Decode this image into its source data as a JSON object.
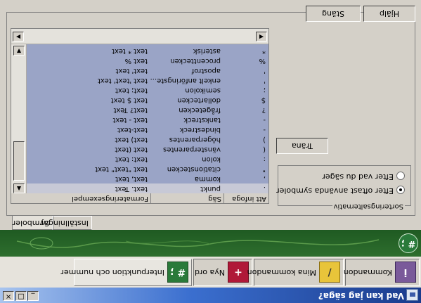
{
  "window": {
    "title": "Vad kan jag säga?",
    "controls": {
      "close": "×",
      "maximize": "□",
      "minimize": "_"
    }
  },
  "nav": {
    "tabs": [
      {
        "label": "Interpunktion och nummer",
        "icon": "punctuation-icon",
        "glyph": "# ;",
        "color": "#2a7a3a",
        "active": true
      },
      {
        "label": "Nya ord",
        "icon": "new-word-icon",
        "glyph": "+",
        "color": "#b01838",
        "active": false
      },
      {
        "label": "Mina kommandon",
        "icon": "pencil-icon",
        "glyph": "/",
        "color": "#e8c43a",
        "active": false
      },
      {
        "label": "Kommandon",
        "icon": "commands-icon",
        "glyph": "i",
        "color": "#7a5a9a",
        "active": false
      }
    ]
  },
  "banner": {
    "badge_glyph": "# ;",
    "color": "#2e6e2e"
  },
  "panel_tabs": [
    {
      "label": "Symboler",
      "active": true
    },
    {
      "label": "Inställningar",
      "active": false
    }
  ],
  "sorting": {
    "legend": "Sorteringsalternativ",
    "options": [
      {
        "label": "Efter oftast använda symboler",
        "selected": true
      },
      {
        "label": "Efter vad du säger",
        "selected": false
      }
    ]
  },
  "buttons": {
    "train": "Träna",
    "close": "Stäng",
    "help": "Hjälp"
  },
  "list": {
    "columns": {
      "write": "Att infoga",
      "say": "Säg",
      "example": "Formateringsexempel"
    },
    "rows": [
      {
        "write": ".",
        "say": "punkt",
        "example": "text. Text",
        "selected": true
      },
      {
        "write": ",",
        "say": "komma",
        "example": "text, text",
        "selected": false
      },
      {
        "write": "\"",
        "say": "citationstecken",
        "example": "text \"text\" text",
        "selected": false
      },
      {
        "write": ":",
        "say": "kolon",
        "example": "text: text",
        "selected": false
      },
      {
        "write": "(",
        "say": "vänsterparentes",
        "example": "text (text",
        "selected": false
      },
      {
        "write": ")",
        "say": "högerparentes",
        "example": "text) text",
        "selected": false
      },
      {
        "write": "-",
        "say": "bindestreck",
        "example": "text-text",
        "selected": false
      },
      {
        "write": "-",
        "say": "tankstreck",
        "example": "text - text",
        "selected": false
      },
      {
        "write": "?",
        "say": "frågetecken",
        "example": "text? Text",
        "selected": false
      },
      {
        "write": "$",
        "say": "dollartecken",
        "example": "text $ text",
        "selected": false
      },
      {
        "write": ";",
        "say": "semikolon",
        "example": "text; text",
        "selected": false
      },
      {
        "write": "'",
        "say": "enkelt anföringste...",
        "example": "text 'text' text",
        "selected": false
      },
      {
        "write": "'",
        "say": "apostrof",
        "example": "text' text",
        "selected": false
      },
      {
        "write": "%",
        "say": "procenttecken",
        "example": "text %",
        "selected": false
      },
      {
        "write": "*",
        "say": "asterisk",
        "example": "text * text",
        "selected": false
      }
    ]
  },
  "colors": {
    "selection": "#9aa4c6",
    "titlebar": "#1a3b8c"
  }
}
